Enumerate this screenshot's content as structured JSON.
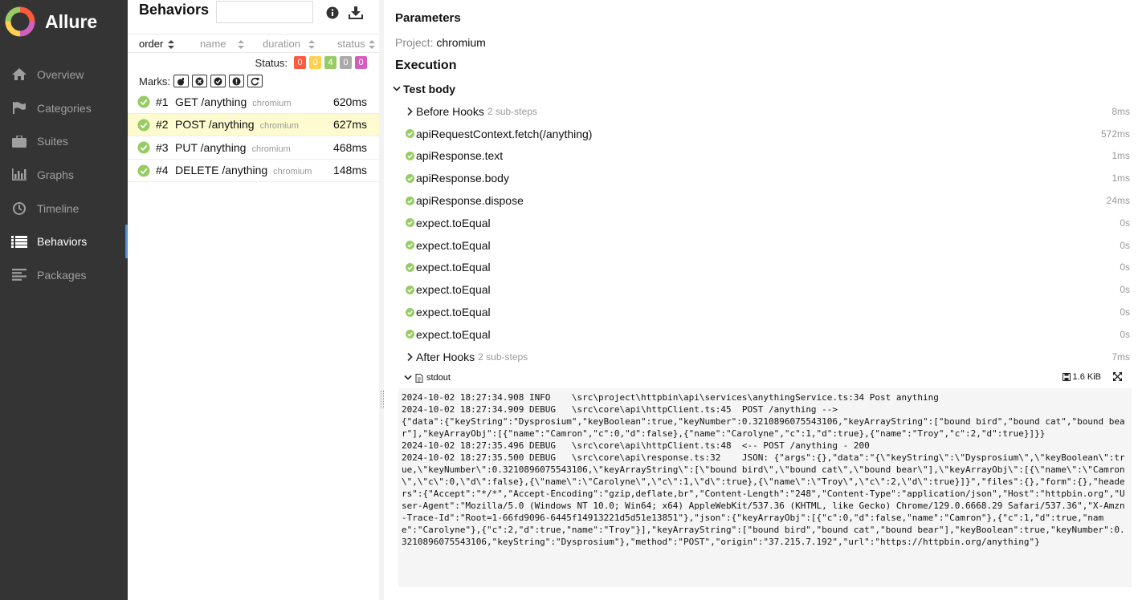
{
  "app": {
    "brand": "Allure"
  },
  "sidebar": {
    "items": [
      {
        "label": "Overview",
        "icon": "home-icon",
        "active": false
      },
      {
        "label": "Categories",
        "icon": "flag-icon",
        "active": false
      },
      {
        "label": "Suites",
        "icon": "briefcase-icon",
        "active": false
      },
      {
        "label": "Graphs",
        "icon": "bar-chart-icon",
        "active": false
      },
      {
        "label": "Timeline",
        "icon": "clock-icon",
        "active": false
      },
      {
        "label": "Behaviors",
        "icon": "list-icon",
        "active": true
      },
      {
        "label": "Packages",
        "icon": "align-left-icon",
        "active": false
      }
    ]
  },
  "behaviors": {
    "title": "Behaviors",
    "search_value": "",
    "sort": {
      "order": "order",
      "name": "name",
      "duration": "duration",
      "status": "status"
    },
    "status_label": "Status:",
    "status_counts": [
      {
        "value": "0",
        "color": "#fd5a3e"
      },
      {
        "value": "0",
        "color": "#ffd050"
      },
      {
        "value": "4",
        "color": "#97cc64"
      },
      {
        "value": "0",
        "color": "#aaaaaa"
      },
      {
        "value": "0",
        "color": "#d35ebe"
      }
    ],
    "marks_label": "Marks:",
    "tests": [
      {
        "num": "#1",
        "name": "GET /anything",
        "env": "chromium",
        "duration": "620ms",
        "selected": false
      },
      {
        "num": "#2",
        "name": "POST /anything",
        "env": "chromium",
        "duration": "627ms",
        "selected": true
      },
      {
        "num": "#3",
        "name": "PUT /anything",
        "env": "chromium",
        "duration": "468ms",
        "selected": false
      },
      {
        "num": "#4",
        "name": "DELETE /anything",
        "env": "chromium",
        "duration": "148ms",
        "selected": false
      }
    ]
  },
  "details": {
    "params_title": "Parameters",
    "param_key": "Project:",
    "param_value": "chromium",
    "execution_title": "Execution",
    "test_body": "Test body",
    "steps": [
      {
        "kind": "group",
        "label": "Before Hooks",
        "sub": "2 sub-steps",
        "duration": "8ms"
      },
      {
        "kind": "passed",
        "label": "apiRequestContext.fetch(/anything)",
        "sub": "",
        "duration": "572ms"
      },
      {
        "kind": "passed",
        "label": "apiResponse.text",
        "sub": "",
        "duration": "1ms"
      },
      {
        "kind": "passed",
        "label": "apiResponse.body",
        "sub": "",
        "duration": "1ms"
      },
      {
        "kind": "passed",
        "label": "apiResponse.dispose",
        "sub": "",
        "duration": "24ms"
      },
      {
        "kind": "passed",
        "label": "expect.toEqual",
        "sub": "",
        "duration": "0s"
      },
      {
        "kind": "passed",
        "label": "expect.toEqual",
        "sub": "",
        "duration": "0s"
      },
      {
        "kind": "passed",
        "label": "expect.toEqual",
        "sub": "",
        "duration": "0s"
      },
      {
        "kind": "passed",
        "label": "expect.toEqual",
        "sub": "",
        "duration": "0s"
      },
      {
        "kind": "passed",
        "label": "expect.toEqual",
        "sub": "",
        "duration": "0s"
      },
      {
        "kind": "passed",
        "label": "expect.toEqual",
        "sub": "",
        "duration": "0s"
      },
      {
        "kind": "group",
        "label": "After Hooks",
        "sub": "2 sub-steps",
        "duration": "7ms"
      }
    ],
    "attachment_name": "stdout",
    "attachment_size": "1.6 KiB",
    "stdout": "2024-10-02 18:27:34.908 INFO    \\src\\project\\httpbin\\api\\services\\anythingService.ts:34 Post anything\n2024-10-02 18:27:34.909 DEBUG   \\src\\core\\api\\httpClient.ts:45  POST /anything -->\n{\"data\":{\"keyString\":\"Dysprosium\",\"keyBoolean\":true,\"keyNumber\":0.3210896075543106,\"keyArrayString\":[\"bound bird\",\"bound cat\",\"bound bear\"],\"keyArrayObj\":[{\"name\":\"Camron\",\"c\":0,\"d\":false},{\"name\":\"Carolyne\",\"c\":1,\"d\":true},{\"name\":\"Troy\",\"c\":2,\"d\":true}]}}\n2024-10-02 18:27:35.496 DEBUG   \\src\\core\\api\\httpClient.ts:48  <-- POST /anything - 200\n2024-10-02 18:27:35.500 DEBUG   \\src\\core\\api\\response.ts:32    JSON: {\"args\":{},\"data\":\"{\\\"keyString\\\":\\\"Dysprosium\\\",\\\"keyBoolean\\\":true,\\\"keyNumber\\\":0.3210896075543106,\\\"keyArrayString\\\":[\\\"bound bird\\\",\\\"bound cat\\\",\\\"bound bear\\\"],\\\"keyArrayObj\\\":[{\\\"name\\\":\\\"Camron\\\",\\\"c\\\":0,\\\"d\\\":false},{\\\"name\\\":\\\"Carolyne\\\",\\\"c\\\":1,\\\"d\\\":true},{\\\"name\\\":\\\"Troy\\\",\\\"c\\\":2,\\\"d\\\":true}]}\",\"files\":{},\"form\":{},\"headers\":{\"Accept\":\"*/*\",\"Accept-Encoding\":\"gzip,deflate,br\",\"Content-Length\":\"248\",\"Content-Type\":\"application/json\",\"Host\":\"httpbin.org\",\"User-Agent\":\"Mozilla/5.0 (Windows NT 10.0; Win64; x64) AppleWebKit/537.36 (KHTML, like Gecko) Chrome/129.0.6668.29 Safari/537.36\",\"X-Amzn-Trace-Id\":\"Root=1-66fd9096-6445f14913221d5d51e13851\"},\"json\":{\"keyArrayObj\":[{\"c\":0,\"d\":false,\"name\":\"Camron\"},{\"c\":1,\"d\":true,\"name\":\"Carolyne\"},{\"c\":2,\"d\":true,\"name\":\"Troy\"}],\"keyArrayString\":[\"bound bird\",\"bound cat\",\"bound bear\"],\"keyBoolean\":true,\"keyNumber\":0.3210896075543106,\"keyString\":\"Dysprosium\"},\"method\":\"POST\",\"origin\":\"37.215.7.192\",\"url\":\"https://httpbin.org/anything\"}"
  },
  "colors": {
    "sidebar_bg": "#343434",
    "passed": "#97cc64",
    "selected_row": "#fdfbcf"
  }
}
